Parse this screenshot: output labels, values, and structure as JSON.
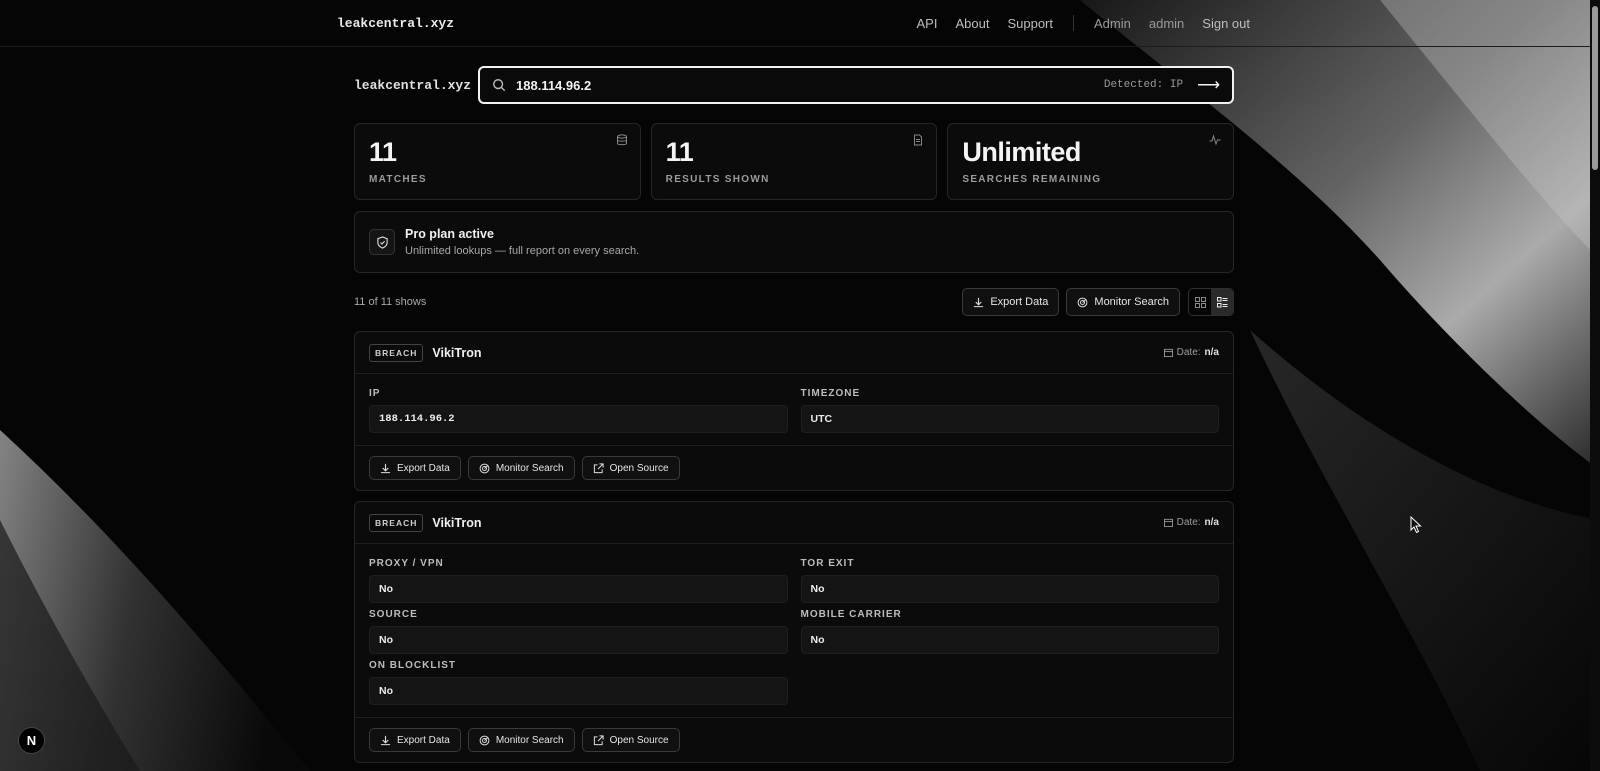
{
  "nav": {
    "brand": "leakcentral.xyz",
    "links": [
      "API",
      "About",
      "Support"
    ],
    "admin": "Admin",
    "user": "admin",
    "signout": "Sign out"
  },
  "search": {
    "brand": "leakcentral.xyz",
    "value": "188.114.96.2",
    "detected": "Detected: IP"
  },
  "stats": [
    {
      "value": "11",
      "label": "MATCHES",
      "icon": "database-icon"
    },
    {
      "value": "11",
      "label": "RESULTS SHOWN",
      "icon": "document-icon"
    },
    {
      "value": "Unlimited",
      "label": "SEARCHES REMAINING",
      "icon": "activity-icon"
    }
  ],
  "plan": {
    "title": "Pro plan active",
    "subtitle": "Unlimited lookups — full report on every search."
  },
  "toolbar": {
    "count": "11 of 11 shows",
    "export": "Export Data",
    "monitor": "Monitor Search"
  },
  "cards": [
    {
      "badge": "BREACH",
      "name": "VikiTron",
      "date_label": "Date:",
      "date_value": "n/a",
      "fields": [
        {
          "label": "IP",
          "value": "188.114.96.2"
        },
        {
          "label": "TIMEZONE",
          "value": "UTC"
        }
      ],
      "actions": [
        "Export Data",
        "Monitor Search",
        "Open Source"
      ]
    },
    {
      "badge": "BREACH",
      "name": "VikiTron",
      "date_label": "Date:",
      "date_value": "n/a",
      "fields": [
        {
          "label": "PROXY / VPN",
          "value": "No"
        },
        {
          "label": "TOR EXIT",
          "value": "No"
        },
        {
          "label": "SOURCE",
          "value": "No"
        },
        {
          "label": "MOBILE CARRIER",
          "value": "No"
        },
        {
          "label": "ON BLOCKLIST",
          "value": "No"
        }
      ],
      "actions": [
        "Export Data",
        "Monitor Search",
        "Open Source"
      ]
    }
  ],
  "dev_badge": "N"
}
